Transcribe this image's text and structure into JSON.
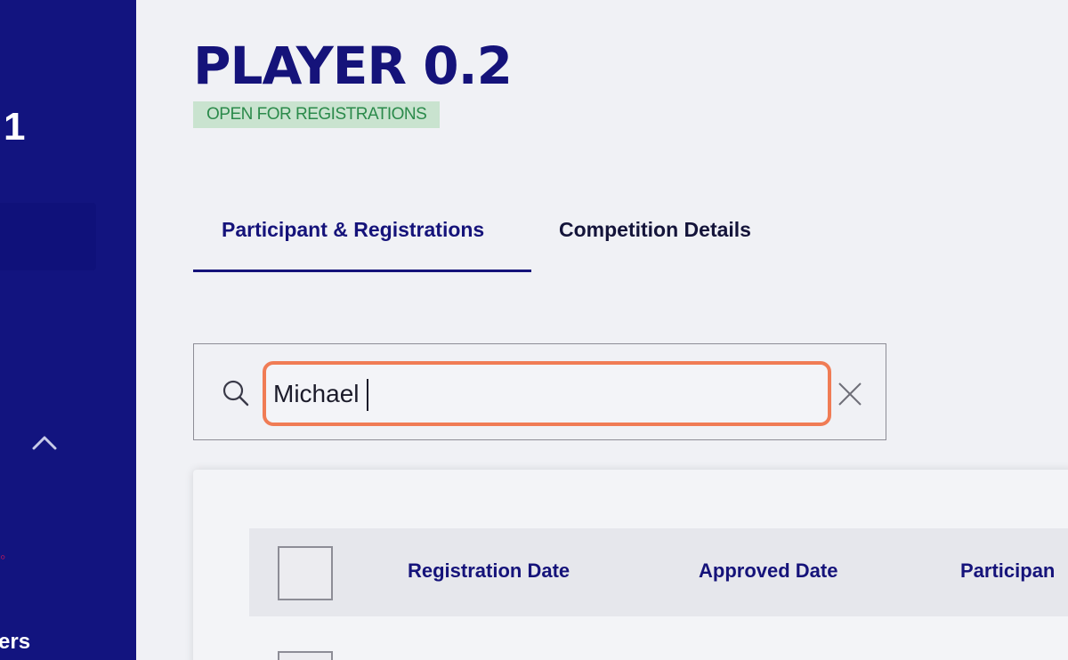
{
  "sidebar": {
    "partial_number": "1",
    "partial_label": "ers"
  },
  "header": {
    "title": "PLAYER 0.2",
    "status": "OPEN FOR REGISTRATIONS"
  },
  "tabs": [
    {
      "label": "Participant & Registrations",
      "active": true
    },
    {
      "label": "Competition Details",
      "active": false
    }
  ],
  "search": {
    "value": "Michael",
    "placeholder": ""
  },
  "table": {
    "columns": [
      "Registration Date",
      "Approved Date",
      "Participan"
    ]
  },
  "colors": {
    "sidebar_bg": "#12147f",
    "brand_navy": "#15137a",
    "status_bg": "#c9e3cf",
    "status_text": "#2b8a4b",
    "focus_ring": "#f07c55"
  }
}
